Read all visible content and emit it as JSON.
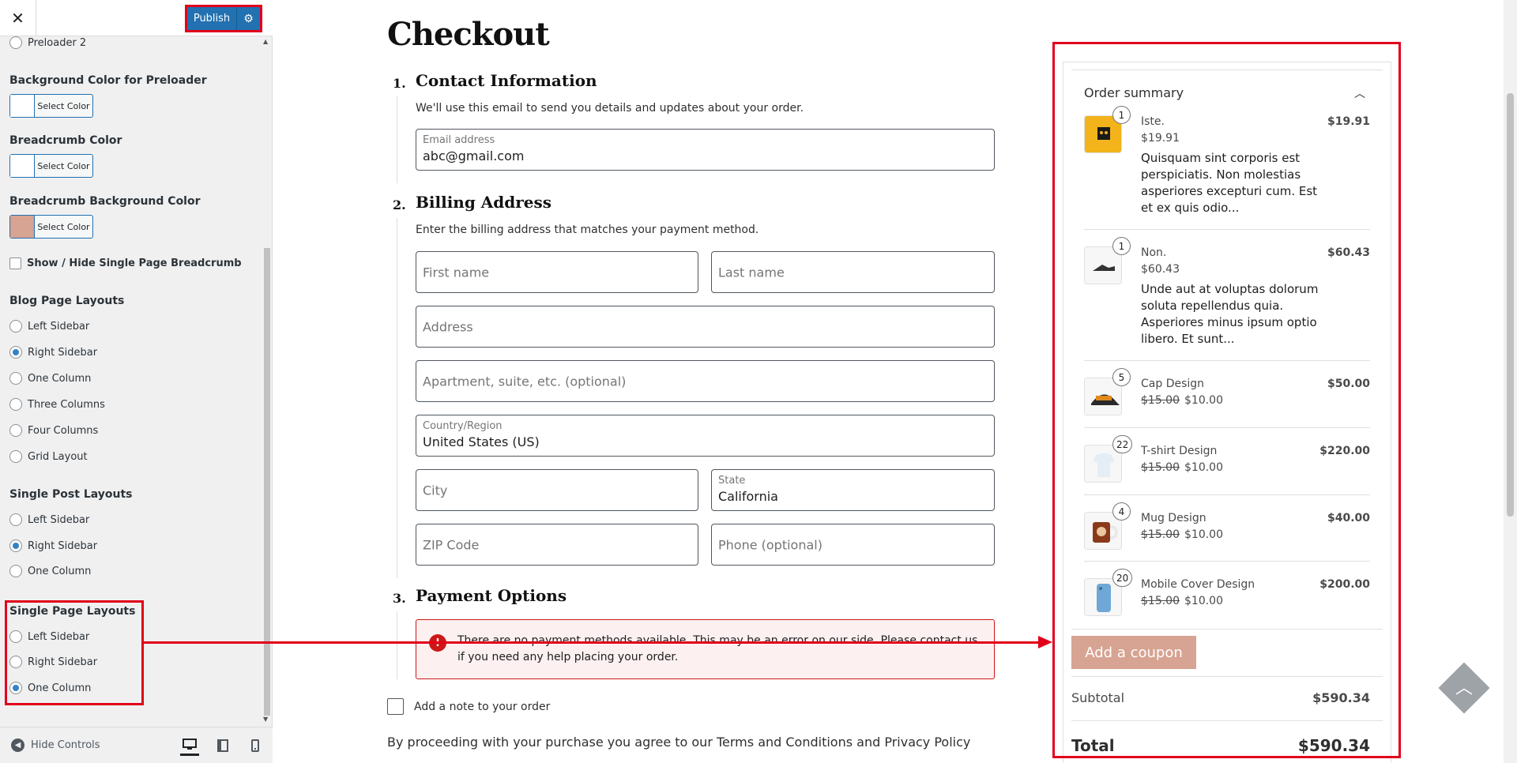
{
  "customizer": {
    "publish_label": "Publish",
    "preloader_option": "Preloader 2",
    "bg_preloader_title": "Background Color for Preloader",
    "breadcrumb_color_title": "Breadcrumb Color",
    "breadcrumb_bg_title": "Breadcrumb Background Color",
    "select_color_label": "Select Color",
    "swatches": [
      "#ffffff",
      "#ffffff",
      "#d7a392"
    ],
    "show_hide_breadcrumb": "Show / Hide Single Page Breadcrumb",
    "blog_layouts": {
      "title": "Blog Page Layouts",
      "options": [
        "Left Sidebar",
        "Right Sidebar",
        "One Column",
        "Three Columns",
        "Four Columns",
        "Grid Layout"
      ],
      "selected": "Right Sidebar"
    },
    "post_layouts": {
      "title": "Single Post Layouts",
      "options": [
        "Left Sidebar",
        "Right Sidebar",
        "One Column"
      ],
      "selected": "Right Sidebar"
    },
    "page_layouts": {
      "title": "Single Page Layouts",
      "options": [
        "Left Sidebar",
        "Right Sidebar",
        "One Column"
      ],
      "selected": "One Column"
    },
    "hide_controls": "Hide Controls",
    "devices": [
      "desktop",
      "tablet",
      "mobile"
    ],
    "active_device": "desktop"
  },
  "checkout": {
    "title": "Checkout",
    "contact": {
      "number": "1.",
      "title": "Contact Information",
      "desc": "We'll use this email to send you details and updates about your order.",
      "email_label": "Email address",
      "email_value": "abc@gmail.com"
    },
    "billing": {
      "number": "2.",
      "title": "Billing Address",
      "desc": "Enter the billing address that matches your payment method.",
      "first_name": "First name",
      "last_name": "Last name",
      "address": "Address",
      "apartment": "Apartment, suite, etc. (optional)",
      "country_label": "Country/Region",
      "country_value": "United States (US)",
      "city": "City",
      "state_label": "State",
      "state_value": "California",
      "zip": "ZIP Code",
      "phone": "Phone (optional)"
    },
    "payment": {
      "number": "3.",
      "title": "Payment Options",
      "notice": "There are no payment methods available. This may be an error on our side. Please contact us if you need any help placing your order."
    },
    "note_label": "Add a note to your order",
    "terms": "By proceeding with your purchase you agree to our Terms and Conditions and Privacy Policy"
  },
  "summary": {
    "title": "Order summary",
    "items": [
      {
        "qty": "1",
        "name": "Iste.",
        "old_price": "",
        "price": "$19.91",
        "desc": "Quisquam sint corporis est perspiciatis. Non molestias asperiores excepturi cum. Est et ex quis odio...",
        "total": "$19.91"
      },
      {
        "qty": "1",
        "name": "Non.",
        "old_price": "",
        "price": "$60.43",
        "desc": "Unde aut at voluptas dolorum soluta repellendus quia. Asperiores minus ipsum optio libero. Et sunt...",
        "total": "$60.43"
      },
      {
        "qty": "5",
        "name": "Cap Design",
        "old_price": "$15.00",
        "price": "$10.00",
        "desc": "",
        "total": "$50.00"
      },
      {
        "qty": "22",
        "name": "T-shirt Design",
        "old_price": "$15.00",
        "price": "$10.00",
        "desc": "",
        "total": "$220.00"
      },
      {
        "qty": "4",
        "name": "Mug Design",
        "old_price": "$15.00",
        "price": "$10.00",
        "desc": "",
        "total": "$40.00"
      },
      {
        "qty": "20",
        "name": "Mobile Cover Design",
        "old_price": "$15.00",
        "price": "$10.00",
        "desc": "",
        "total": "$200.00"
      }
    ],
    "coupon_label": "Add a coupon",
    "subtotal_label": "Subtotal",
    "subtotal_value": "$590.34",
    "total_label": "Total",
    "total_value": "$590.34"
  },
  "colors": {
    "annotation": "#e1001a",
    "publish": "#2271b1",
    "coupon": "#d7a392",
    "error": "#cc1818"
  }
}
